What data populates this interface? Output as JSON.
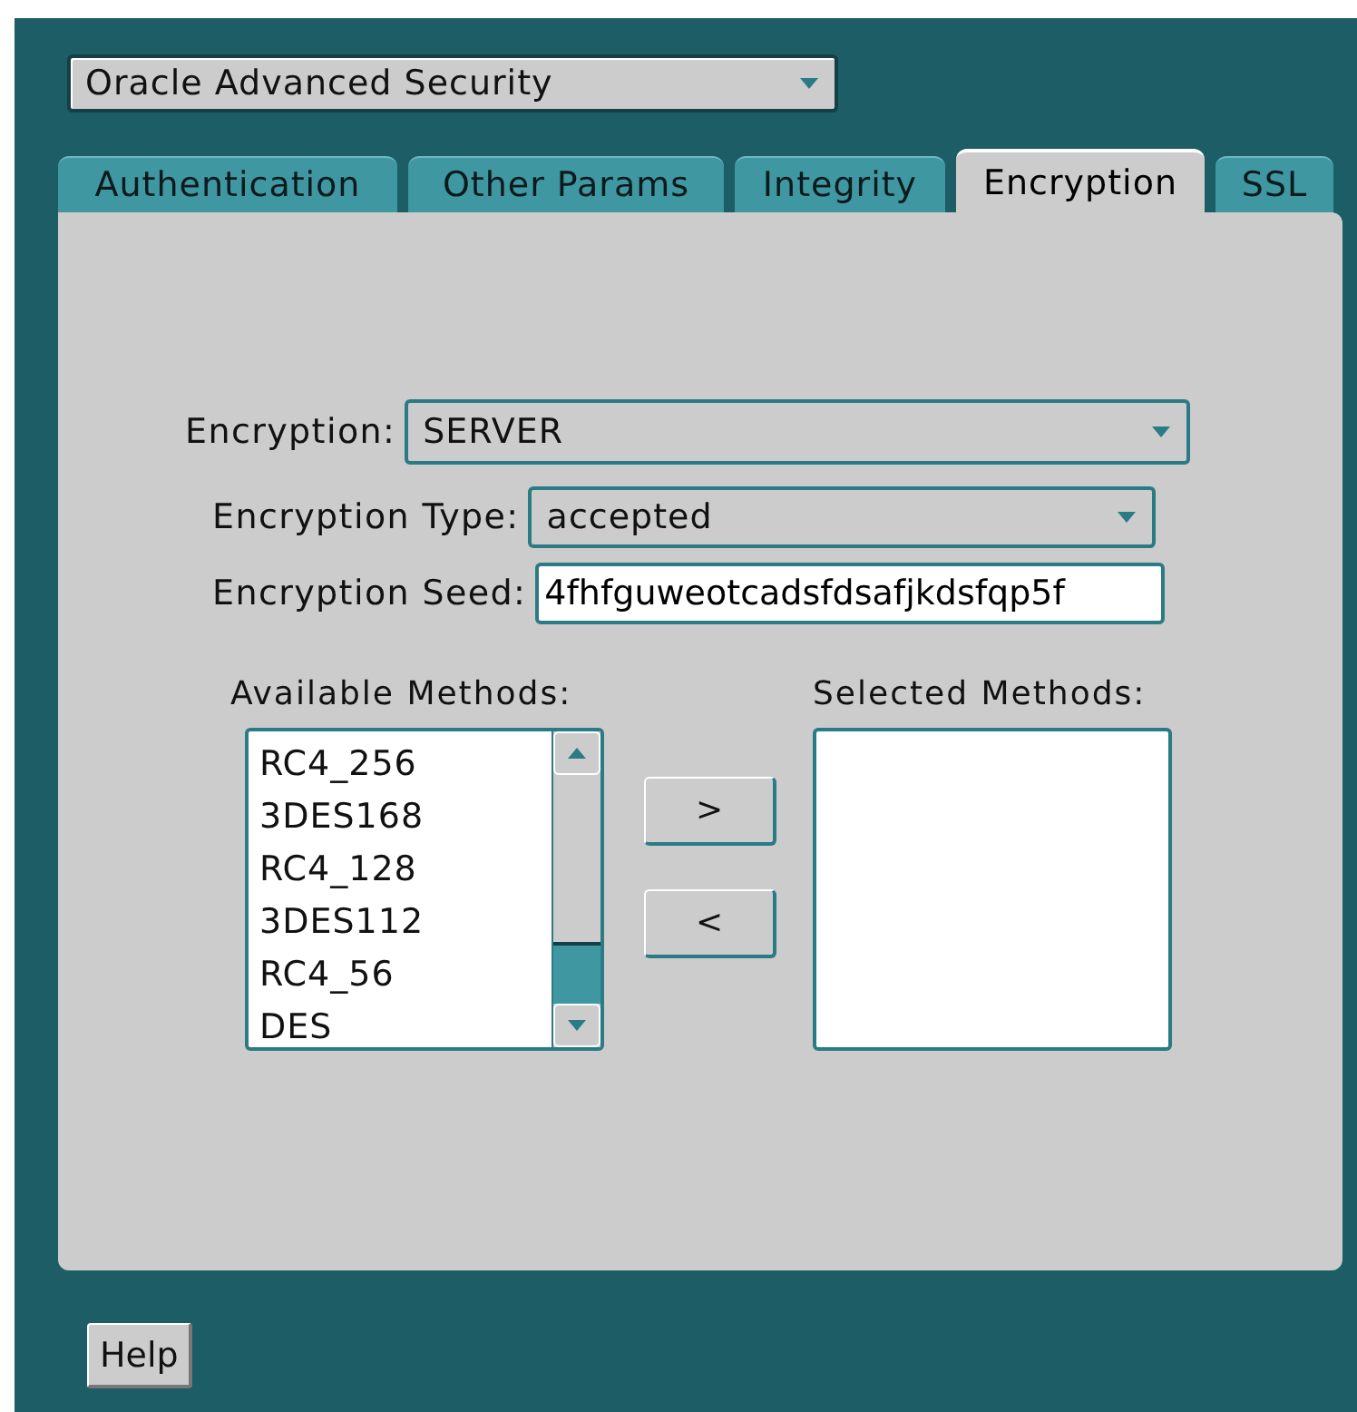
{
  "service_select": {
    "value": "Oracle Advanced Security"
  },
  "tabs": [
    {
      "label": "Authentication",
      "selected": false
    },
    {
      "label": "Other Params",
      "selected": false
    },
    {
      "label": "Integrity",
      "selected": false
    },
    {
      "label": "Encryption",
      "selected": true
    },
    {
      "label": "SSL",
      "selected": false
    }
  ],
  "fields": [
    {
      "label": "Encryption:",
      "kind": "select",
      "value": "SERVER"
    },
    {
      "label": "Encryption Type:",
      "kind": "select",
      "value": "accepted"
    },
    {
      "label": "Encryption Seed:",
      "kind": "text",
      "value": "4fhfguweotcadsfdsafjkdsfqp5f"
    }
  ],
  "available_methods": {
    "label": "Available Methods:",
    "items": [
      "RC4_256",
      "3DES168",
      "RC4_128",
      "3DES112",
      "RC4_56",
      "DES"
    ]
  },
  "move_buttons": [
    ">",
    "<"
  ],
  "selected_methods": {
    "label": "Selected Methods:"
  },
  "help_button": "Help"
}
